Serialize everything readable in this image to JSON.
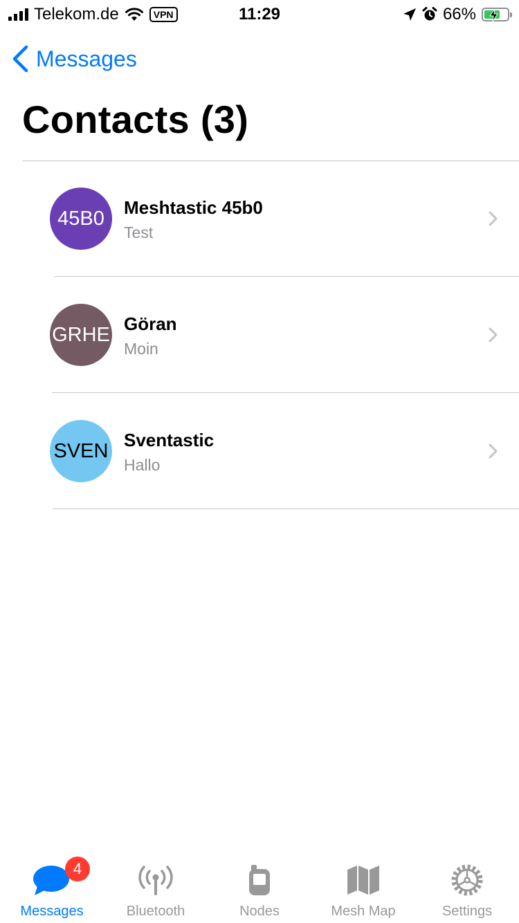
{
  "status_bar": {
    "carrier": "Telekom.de",
    "vpn": "VPN",
    "time": "11:29",
    "battery": "66%",
    "icons": [
      "signal-icon",
      "wifi-icon",
      "location-arrow-icon",
      "alarm-icon",
      "battery-charging-icon"
    ]
  },
  "nav": {
    "back_label": "Messages",
    "title": "Contacts (3)"
  },
  "contacts": [
    {
      "avatar_text": "45B0",
      "name": "Meshtastic 45b0",
      "preview": "Test",
      "avatar_color": "#6a3fb4",
      "avatar_text_color": "#ffffff"
    },
    {
      "avatar_text": "GRHE",
      "name": "Göran",
      "preview": "Moin",
      "avatar_color": "#735a63",
      "avatar_text_color": "#ffffff"
    },
    {
      "avatar_text": "SVEN",
      "name": "Sventastic",
      "preview": "Hallo",
      "avatar_color": "#74c7f1",
      "avatar_text_color": "#000000"
    }
  ],
  "tab_bar": {
    "tabs": [
      {
        "label": "Messages",
        "icon": "chat-bubble-icon",
        "active": true,
        "badge": "4"
      },
      {
        "label": "Bluetooth",
        "icon": "antenna-icon",
        "active": false
      },
      {
        "label": "Nodes",
        "icon": "device-icon",
        "active": false
      },
      {
        "label": "Mesh Map",
        "icon": "map-icon",
        "active": false
      },
      {
        "label": "Settings",
        "icon": "gear-icon",
        "active": false
      }
    ]
  },
  "colors": {
    "accent": "#007aff",
    "inactive_tab": "#999999",
    "badge": "#ff3b30",
    "battery_fill": "#34c759"
  }
}
